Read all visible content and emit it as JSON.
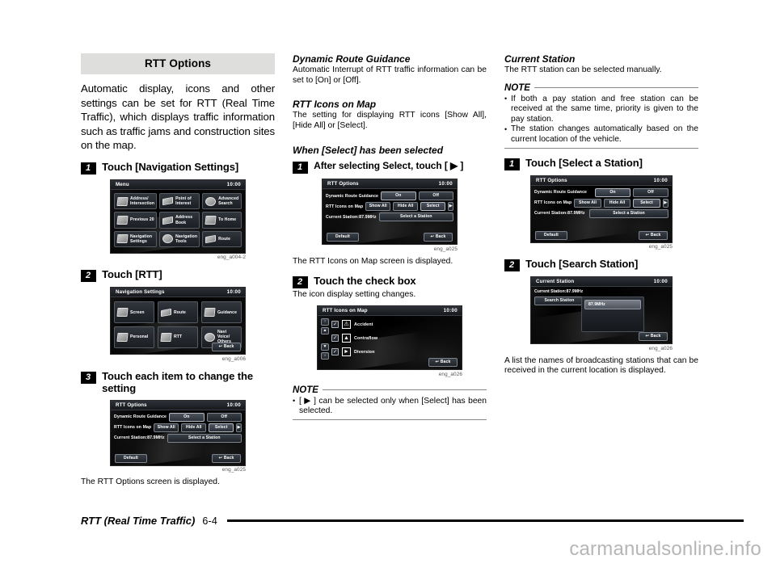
{
  "banner": {
    "title": "RTT Options"
  },
  "intro": "Automatic display, icons and other settings can be set for RTT (Real Time Traffic), which displays traffic information such as traffic jams and construction sites on the map.",
  "left": {
    "step1": {
      "num": "1",
      "text": "Touch [Navigation Settings]"
    },
    "menu_screen": {
      "title": "Menu",
      "clock": "10:00",
      "tiles": [
        "Address/ Intersection",
        "Point of Interest",
        "Advanced Search",
        "Previous 20",
        "Address Book",
        "To Home",
        "Navigation Settings",
        "Navigation Tools",
        "Route"
      ],
      "caption": "eng_a004-2"
    },
    "step2": {
      "num": "2",
      "text": "Touch [RTT]"
    },
    "navset_screen": {
      "title": "Navigation Settings",
      "clock": "10:00",
      "tiles": [
        "Screen",
        "Route",
        "Guidance",
        "Personal",
        "RTT",
        "Navi Voice/ Others"
      ],
      "back": "Back",
      "caption": "eng_a006"
    },
    "step3": {
      "num": "3",
      "text": "Touch each item to change the setting"
    },
    "rtt_screen": {
      "title": "RTT Options",
      "clock": "10:00",
      "rows": [
        {
          "label": "Dynamic Route Guidance",
          "buttons": [
            "On",
            "Off"
          ]
        },
        {
          "label": "RTT Icons on Map",
          "buttons": [
            "Show All",
            "Hide All",
            "Select",
            "▶"
          ]
        },
        {
          "label": "Current Station:87.9MHz",
          "buttons": [
            "Select a Station"
          ]
        }
      ],
      "default": "Default",
      "back": "Back",
      "caption": "eng_a025"
    },
    "after_text": "The RTT Options screen is displayed."
  },
  "mid": {
    "h1": "Dynamic Route Guidance",
    "p1": "Automatic Interrupt of RTT traffic information can be set to [On] or [Off].",
    "h2": "RTT Icons on Map",
    "p2": "The setting for displaying RTT icons [Show All], [Hide All] or [Select].",
    "h3": "When [Select] has been selected",
    "step1": {
      "num": "1",
      "text": "After selecting Select, touch [ ▶ ]"
    },
    "rtt_screen": {
      "title": "RTT Options",
      "clock": "10:00",
      "rows": [
        {
          "label": "Dynamic Route Guidance",
          "buttons": [
            "On",
            "Off"
          ]
        },
        {
          "label": "RTT Icons on Map",
          "buttons": [
            "Show All",
            "Hide All",
            "Select",
            "▶"
          ]
        },
        {
          "label": "Current Station:87.9MHz",
          "buttons": [
            "Select a Station"
          ]
        }
      ],
      "default": "Default",
      "back": "Back",
      "caption": "eng_a025"
    },
    "after_text": "The RTT Icons on Map screen is displayed.",
    "step2": {
      "num": "2",
      "text": "Touch the check box"
    },
    "p3": "The icon display setting changes.",
    "icons_screen": {
      "title": "RTT Icons on Map",
      "clock": "10:00",
      "items": [
        "Accident",
        "Contraflow",
        "Diversion"
      ],
      "back": "Back",
      "caption": "eng_a026"
    },
    "note": {
      "label": "NOTE",
      "items": [
        "[ ▶ ] can be selected only when [Select] has been selected."
      ]
    }
  },
  "right": {
    "h1": "Current Station",
    "p1": "The RTT station can be selected manually.",
    "note": {
      "label": "NOTE",
      "items": [
        "If both a pay station and free station can be received at the same time, priority is given to the pay station.",
        "The station changes automatically based on the current location of the vehicle."
      ]
    },
    "step1": {
      "num": "1",
      "text": "Touch [Select a Station]"
    },
    "rtt_screen": {
      "title": "RTT Options",
      "clock": "10:00",
      "rows": [
        {
          "label": "Dynamic Route Guidance",
          "buttons": [
            "On",
            "Off"
          ]
        },
        {
          "label": "RTT Icons on Map",
          "buttons": [
            "Show All",
            "Hide All",
            "Select",
            "▶"
          ]
        },
        {
          "label": "Current Station:87.9MHz",
          "buttons": [
            "Select a Station"
          ]
        }
      ],
      "default": "Default",
      "back": "Back",
      "caption": "eng_a025"
    },
    "step2": {
      "num": "2",
      "text": "Touch [Search Station]"
    },
    "station_screen": {
      "title": "Current Station",
      "clock": "10:00",
      "current": "Current Station:87.9MHz",
      "search_button": "Search Station",
      "list": [
        "87.9MHz"
      ],
      "back": "Back",
      "caption": "eng_a026"
    },
    "after_text": "A list the names of broadcasting stations that can be received in the current location is displayed."
  },
  "footer": {
    "title": "RTT (Real Time Traffic)",
    "page": "6-4"
  },
  "watermark": "carmanualsonline.info"
}
